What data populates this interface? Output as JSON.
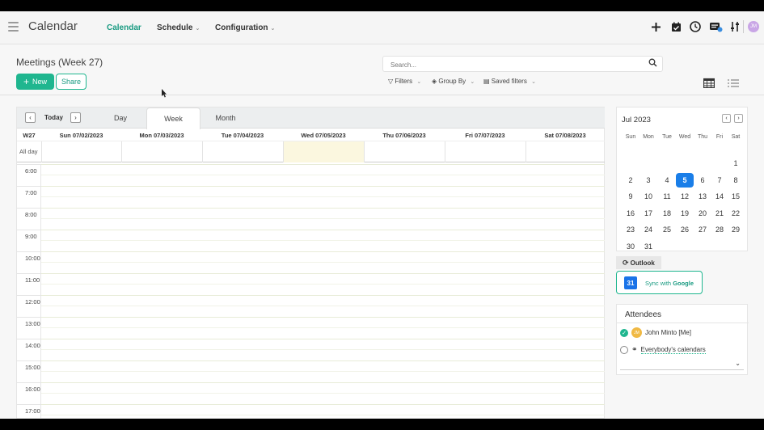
{
  "app": {
    "title": "Calendar"
  },
  "nav": {
    "items": [
      {
        "label": "Calendar",
        "active": true
      },
      {
        "label": "Schedule",
        "dropdown": true
      },
      {
        "label": "Configuration",
        "dropdown": true
      }
    ]
  },
  "topbar_icons": [
    "plus-icon",
    "calendar-check-icon",
    "clock-icon",
    "chat-icon",
    "settings-sliders-icon"
  ],
  "user": {
    "initials": "JM"
  },
  "view": {
    "title": "Meetings (Week 27)"
  },
  "buttons": {
    "new_label": "New",
    "share_label": "Share"
  },
  "search": {
    "placeholder": "Search..."
  },
  "filters": {
    "filters_label": "Filters",
    "groupby_label": "Group By",
    "saved_label": "Saved filters"
  },
  "calendar": {
    "today_label": "Today",
    "tabs": [
      {
        "label": "Day"
      },
      {
        "label": "Week",
        "active": true
      },
      {
        "label": "Month"
      }
    ],
    "week_label": "W27",
    "days": [
      "Sun 07/02/2023",
      "Mon 07/03/2023",
      "Tue 07/04/2023",
      "Wed 07/05/2023",
      "Thu 07/06/2023",
      "Fri 07/07/2023",
      "Sat 07/08/2023"
    ],
    "highlighted_day": "Wed 07/05/2023",
    "allday_label": "All day",
    "hours": [
      "6:00",
      "7:00",
      "8:00",
      "9:00",
      "10:00",
      "11:00",
      "12:00",
      "13:00",
      "14:00",
      "15:00",
      "16:00",
      "17:00"
    ]
  },
  "mini_calendar": {
    "title": "Jul 2023",
    "weekdays": [
      "Sun",
      "Mon",
      "Tue",
      "Wed",
      "Thu",
      "Fri",
      "Sat"
    ],
    "weeks": [
      [
        "",
        "",
        "",
        "",
        "",
        "",
        "1"
      ],
      [
        "2",
        "3",
        "4",
        "5",
        "6",
        "7",
        "8"
      ],
      [
        "9",
        "10",
        "11",
        "12",
        "13",
        "14",
        "15"
      ],
      [
        "16",
        "17",
        "18",
        "19",
        "20",
        "21",
        "22"
      ],
      [
        "23",
        "24",
        "25",
        "26",
        "27",
        "28",
        "29"
      ],
      [
        "30",
        "31",
        "",
        "",
        "",
        "",
        ""
      ]
    ],
    "selected": "5"
  },
  "sync": {
    "outlook_label": "Outlook",
    "google_label_prefix": "Sync with ",
    "google_label_brand": "Google",
    "google_icon_text": "31"
  },
  "attendees": {
    "title": "Attendees",
    "items": [
      {
        "label": "John Minto [Me]",
        "checked": true,
        "initials": "JM"
      },
      {
        "label": "Everybody's calendars",
        "checked": false
      }
    ]
  },
  "colors": {
    "accent": "#1fb68f",
    "today_blue": "#1a7ee8",
    "highlight_day": "#fbf7df"
  }
}
